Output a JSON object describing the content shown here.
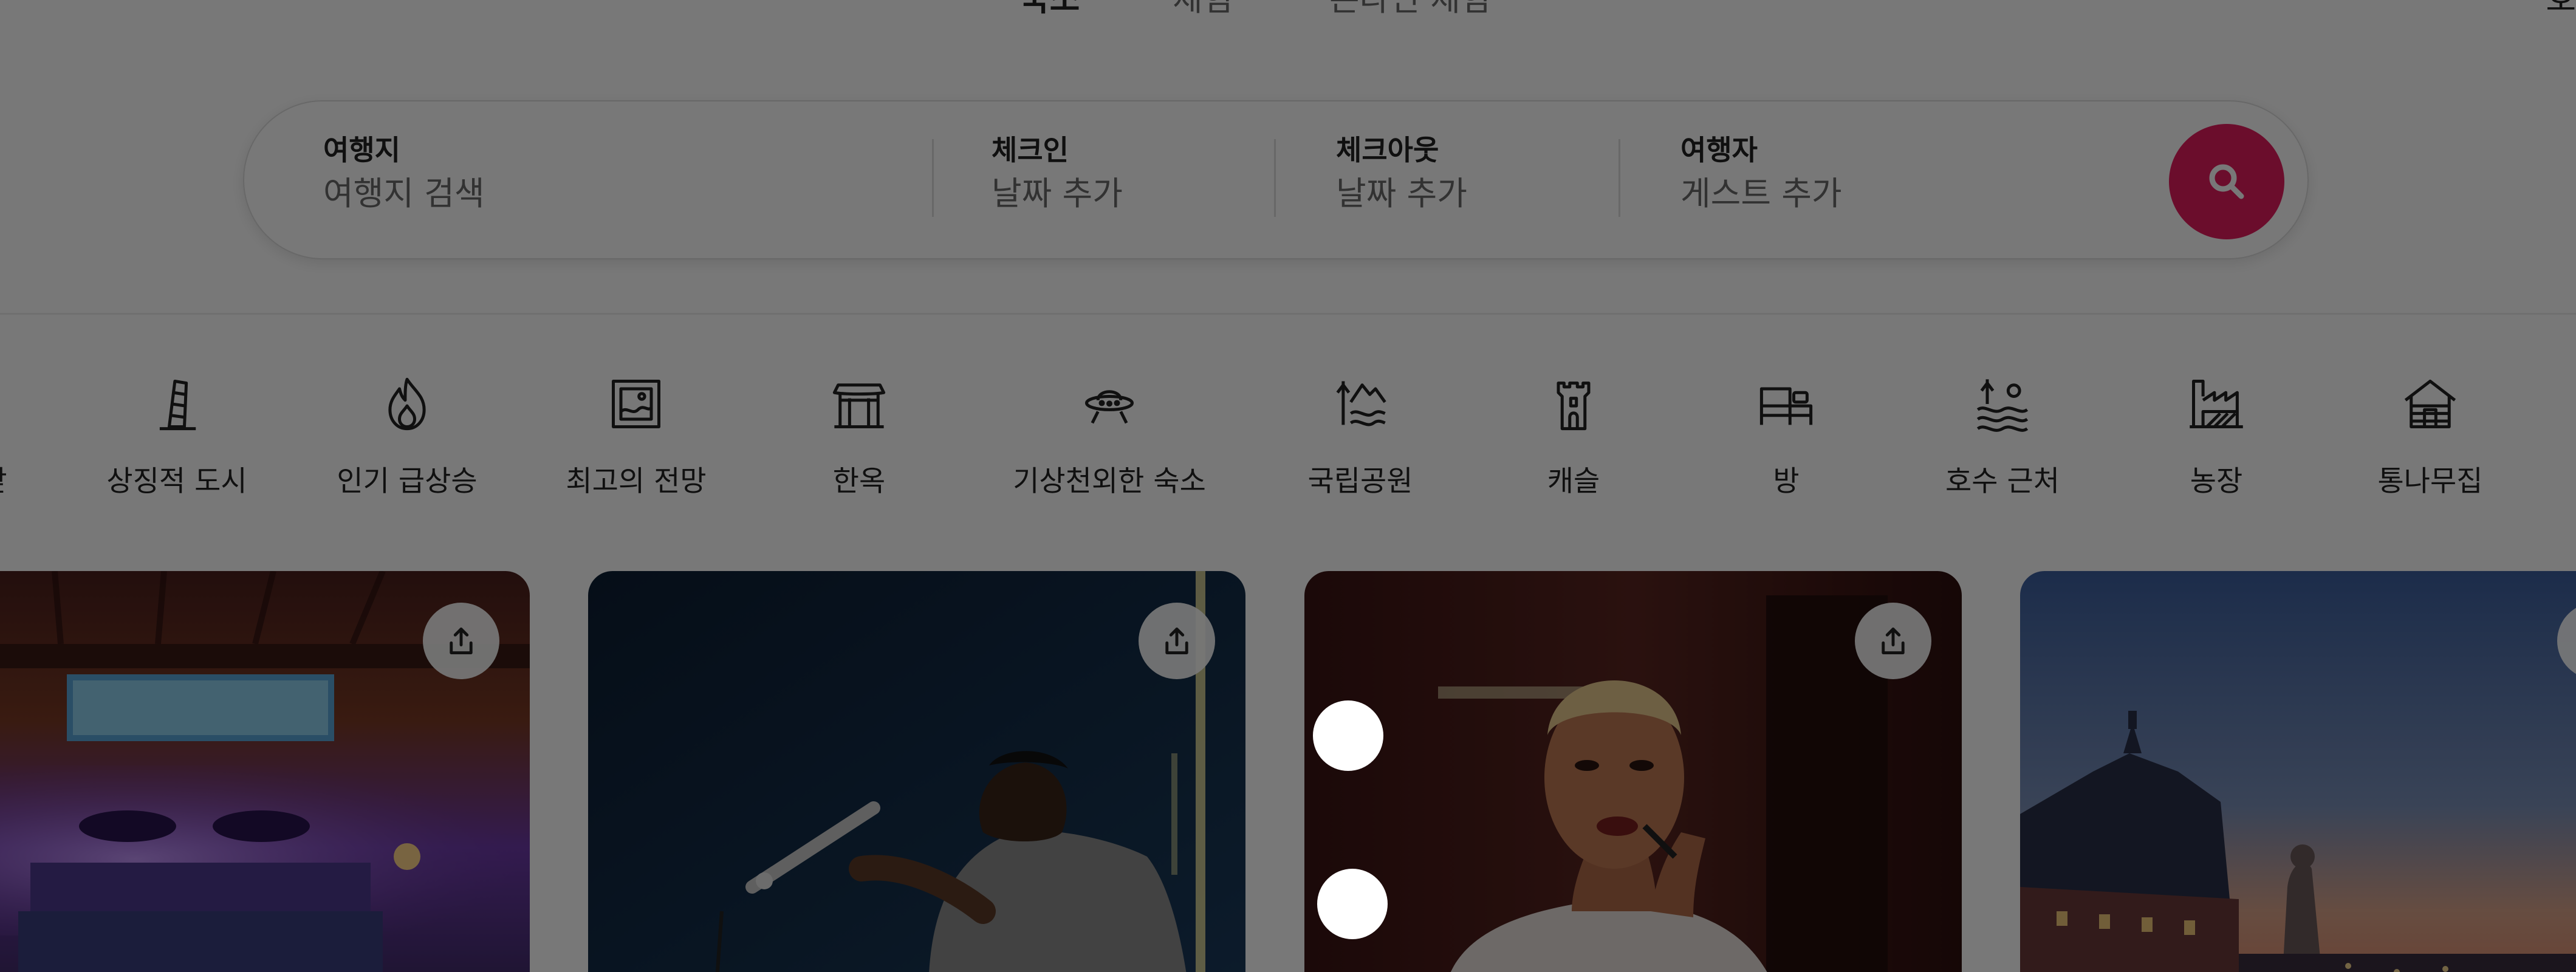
{
  "nav": {
    "tabs": [
      {
        "label": "숙소"
      },
      {
        "label": "체험"
      },
      {
        "label": "온라인 체험"
      }
    ],
    "right_text": "호"
  },
  "search": {
    "where": {
      "label": "여행지",
      "placeholder": "여행지 검색"
    },
    "checkin": {
      "label": "체크인",
      "placeholder": "날짜 추가"
    },
    "checkout": {
      "label": "체크아웃",
      "placeholder": "날짜 추가"
    },
    "guests": {
      "label": "여행자",
      "placeholder": "게스트 추가"
    },
    "button_icon": "search-icon",
    "button_color": "#e31c5f"
  },
  "categories": [
    {
      "label": "앞",
      "icon": "partial-icon"
    },
    {
      "label": "상징적 도시",
      "icon": "leaning-tower-icon"
    },
    {
      "label": "인기 급상승",
      "icon": "flame-icon"
    },
    {
      "label": "최고의 전망",
      "icon": "view-frame-icon"
    },
    {
      "label": "한옥",
      "icon": "hanok-icon"
    },
    {
      "label": "기상천외한 숙소",
      "icon": "ufo-icon"
    },
    {
      "label": "국립공원",
      "icon": "mountain-park-icon"
    },
    {
      "label": "캐슬",
      "icon": "castle-icon"
    },
    {
      "label": "방",
      "icon": "bed-room-icon"
    },
    {
      "label": "호수 근처",
      "icon": "lake-icon"
    },
    {
      "label": "농장",
      "icon": "farm-icon"
    },
    {
      "label": "통나무집",
      "icon": "cabin-icon"
    }
  ],
  "listings": [
    {
      "subject": "room-with-eyes-mural",
      "share_icon": "share-icon"
    },
    {
      "subject": "performer-with-microphone",
      "share_icon": "share-icon"
    },
    {
      "subject": "person-applying-lipstick",
      "share_icon": "share-icon"
    },
    {
      "subject": "palace-rooftop-at-dusk",
      "share_icon": "share-icon"
    }
  ],
  "colors": {
    "accent": "#e31c5f",
    "overlay": "rgba(0,0,0,0.53)"
  }
}
